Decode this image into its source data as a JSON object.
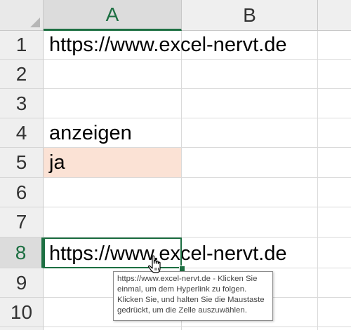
{
  "columns": [
    {
      "label": "A",
      "selected": true
    },
    {
      "label": "B",
      "selected": false
    }
  ],
  "rows": [
    {
      "label": "1",
      "a": "https://www.excel-nervt.de",
      "selected": false
    },
    {
      "label": "2",
      "a": "",
      "selected": false
    },
    {
      "label": "3",
      "a": "",
      "selected": false
    },
    {
      "label": "4",
      "a": "anzeigen",
      "selected": false
    },
    {
      "label": "5",
      "a": "ja",
      "selected": false
    },
    {
      "label": "6",
      "a": "",
      "selected": false
    },
    {
      "label": "7",
      "a": "",
      "selected": false
    },
    {
      "label": "8",
      "a": "https://www.excel-nervt.de",
      "selected": true
    },
    {
      "label": "9",
      "a": "",
      "selected": false
    },
    {
      "label": "10",
      "a": "",
      "selected": false
    }
  ],
  "highlighted_cell": {
    "ref": "A5",
    "fill_color": "#fbe2d5"
  },
  "active_cell": {
    "ref": "A8",
    "border_color": "#1d6f42"
  },
  "tooltip": {
    "lines": [
      "https://www.excel-nervt.de - Klicken Sie",
      "einmal, um dem Hyperlink zu folgen.",
      "Klicken Sie, und halten Sie die Maustaste",
      "gedrückt, um die Zelle auszuwählen."
    ]
  },
  "cursor": {
    "icon": "hand-pointer-icon"
  }
}
